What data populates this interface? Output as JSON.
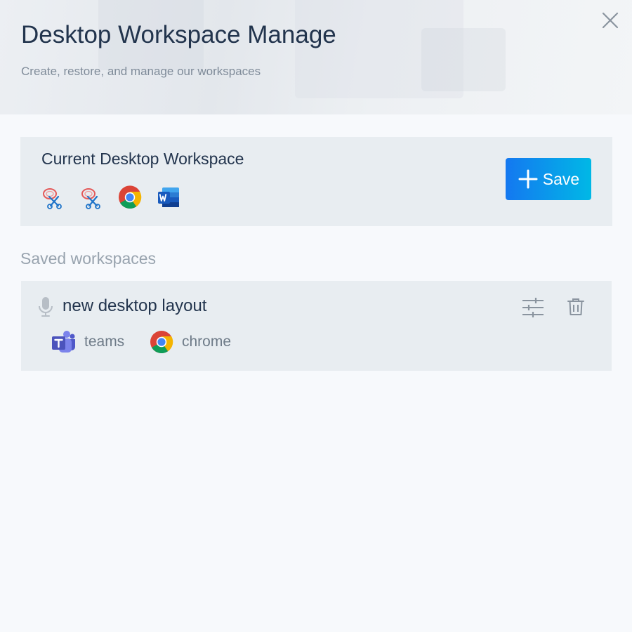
{
  "header": {
    "title": "Desktop Workspace Manage",
    "subtitle": "Create, restore, and manage our workspaces",
    "close_icon": "close-icon"
  },
  "current_workspace": {
    "title": "Current Desktop Workspace",
    "app_icons": [
      "snipping-tool-icon",
      "snipping-tool-icon",
      "chrome-icon",
      "word-icon"
    ],
    "save_label": "Save",
    "save_icon": "plus-icon"
  },
  "saved_section": {
    "label": "Saved workspaces",
    "workspaces": [
      {
        "name": "new desktop layout",
        "icon": "microphone-icon",
        "apps": [
          {
            "label": "teams",
            "icon": "teams-icon"
          },
          {
            "label": "chrome",
            "icon": "chrome-icon"
          }
        ],
        "actions": [
          "settings-sliders-icon",
          "trash-icon"
        ]
      }
    ]
  },
  "colors": {
    "page_bg": "#f7f9fc",
    "card_bg": "#e8edf1",
    "title_text": "#22344d",
    "muted_text": "#98a3ae",
    "save_gradient_start": "#1478f0",
    "save_gradient_end": "#00b8e6"
  }
}
